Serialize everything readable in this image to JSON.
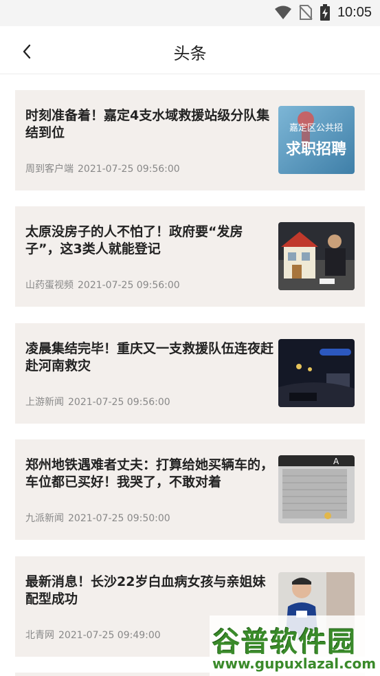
{
  "status_bar": {
    "time": "10:05"
  },
  "header": {
    "title": "头条"
  },
  "articles": [
    {
      "title": "时刻准备着！嘉定4支水域救援站级分队集结到位",
      "source": "周到客户端",
      "date": "2021-07-25 09:56:00",
      "thumb_text_top": "嘉定区公共招",
      "thumb_text_bottom": "求职招聘"
    },
    {
      "title": "太原没房子的人不怕了！政府要“发房子”，这3类人就能登记",
      "source": "山药蛋视频",
      "date": "2021-07-25 09:56:00"
    },
    {
      "title": "凌晨集结完毕！重庆又一支救援队伍连夜赶赴河南救灾",
      "source": "上游新闻",
      "date": "2021-07-25 09:56:00"
    },
    {
      "title": "郑州地铁遇难者丈夫：打算给她买辆车的，车位都已买好！我哭了，不敢对着",
      "source": "九派新闻",
      "date": "2021-07-25 09:50:00",
      "thumb_sign": "A"
    },
    {
      "title": "最新消息！长沙22岁白血病女孩与亲姐妹配型成功",
      "source": "北青网",
      "date": "2021-07-25 09:49:00"
    }
  ],
  "watermark": {
    "name": "谷普软件园",
    "url": "www.gupuxlazal.com"
  },
  "colors": {
    "card_bg": "#f3efec",
    "title": "#222222",
    "meta": "#888888",
    "watermark": "#3a8a2a"
  }
}
